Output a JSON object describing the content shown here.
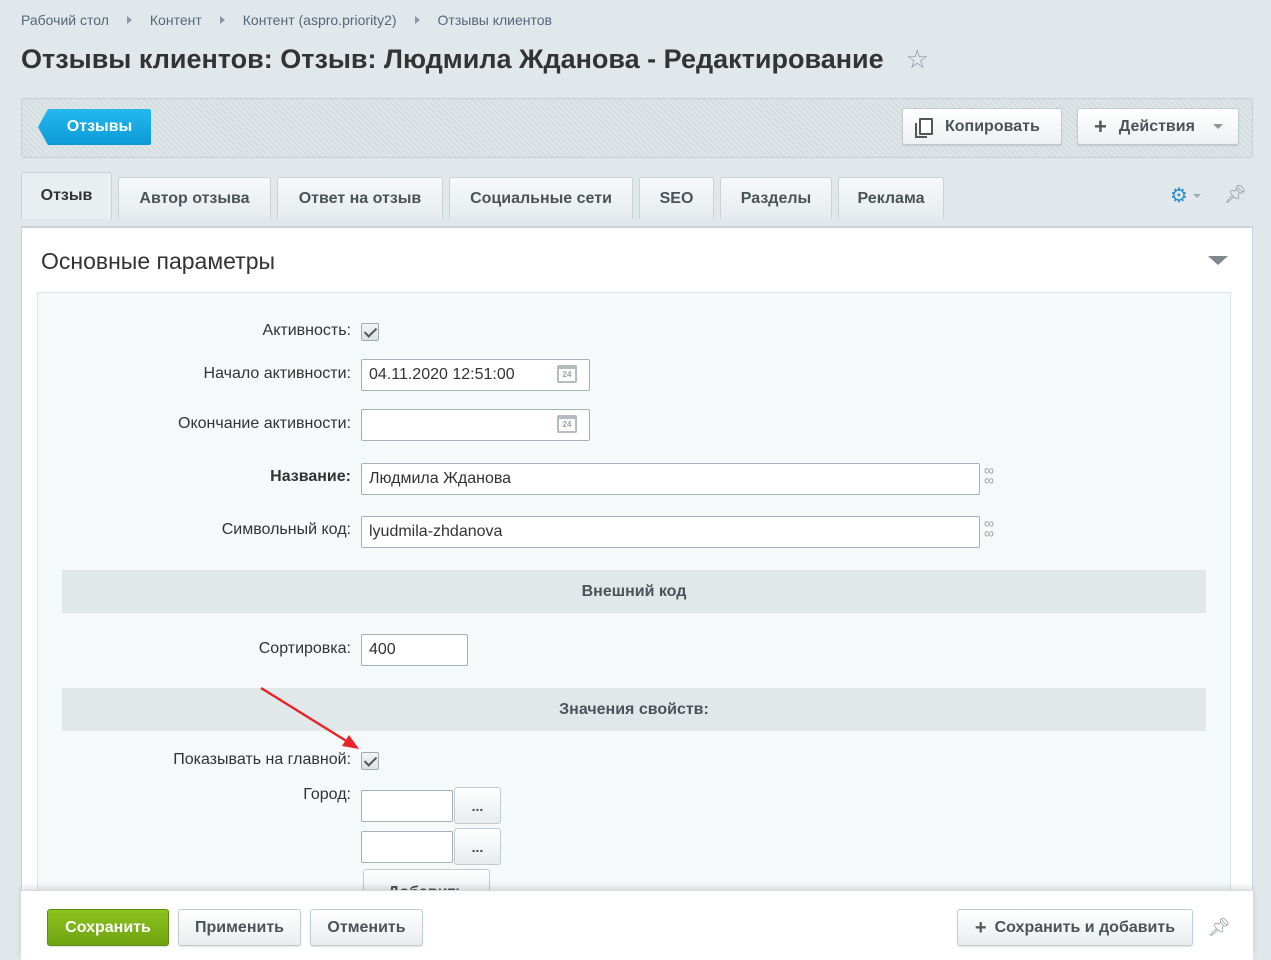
{
  "breadcrumb": [
    "Рабочий стол",
    "Контент",
    "Контент (aspro.priority2)",
    "Отзывы клиентов"
  ],
  "title": "Отзывы клиентов: Отзыв: Людмила Жданова - Редактирование",
  "toolbar": {
    "back_label": "Отзывы",
    "copy_label": "Копировать",
    "actions_label": "Действия"
  },
  "tabs": [
    {
      "label": "Отзыв",
      "active": true
    },
    {
      "label": "Автор отзыва",
      "active": false
    },
    {
      "label": "Ответ на отзыв",
      "active": false
    },
    {
      "label": "Социальные сети",
      "active": false
    },
    {
      "label": "SEO",
      "active": false
    },
    {
      "label": "Разделы",
      "active": false
    },
    {
      "label": "Реклама",
      "active": false
    }
  ],
  "section": {
    "title": "Основные параметры"
  },
  "form": {
    "active_label": "Активность:",
    "active_checked": true,
    "start_label": "Начало активности:",
    "start_value": "04.11.2020 12:51:00",
    "end_label": "Окончание активности:",
    "end_value": "",
    "name_label": "Название:",
    "name_value": "Людмила Жданова",
    "code_label": "Символьный код:",
    "code_value": "lyudmila-zhdanova",
    "external_code_header": "Внешний код",
    "sort_label": "Сортировка:",
    "sort_value": "400",
    "properties_header": "Значения свойств:",
    "show_main_label": "Показывать на главной:",
    "show_main_checked": true,
    "city_label": "Город:",
    "city_values": [
      "",
      ""
    ],
    "dots_label": "...",
    "add_label": "Добавить",
    "calendar_day": "24"
  },
  "footer": {
    "save_label": "Сохранить",
    "apply_label": "Применить",
    "cancel_label": "Отменить",
    "save_add_label": "Сохранить и добавить"
  },
  "colors": {
    "accent_blue": "#0b9ad6",
    "save_green": "#7cb518",
    "annotation_red": "#e8242b"
  }
}
